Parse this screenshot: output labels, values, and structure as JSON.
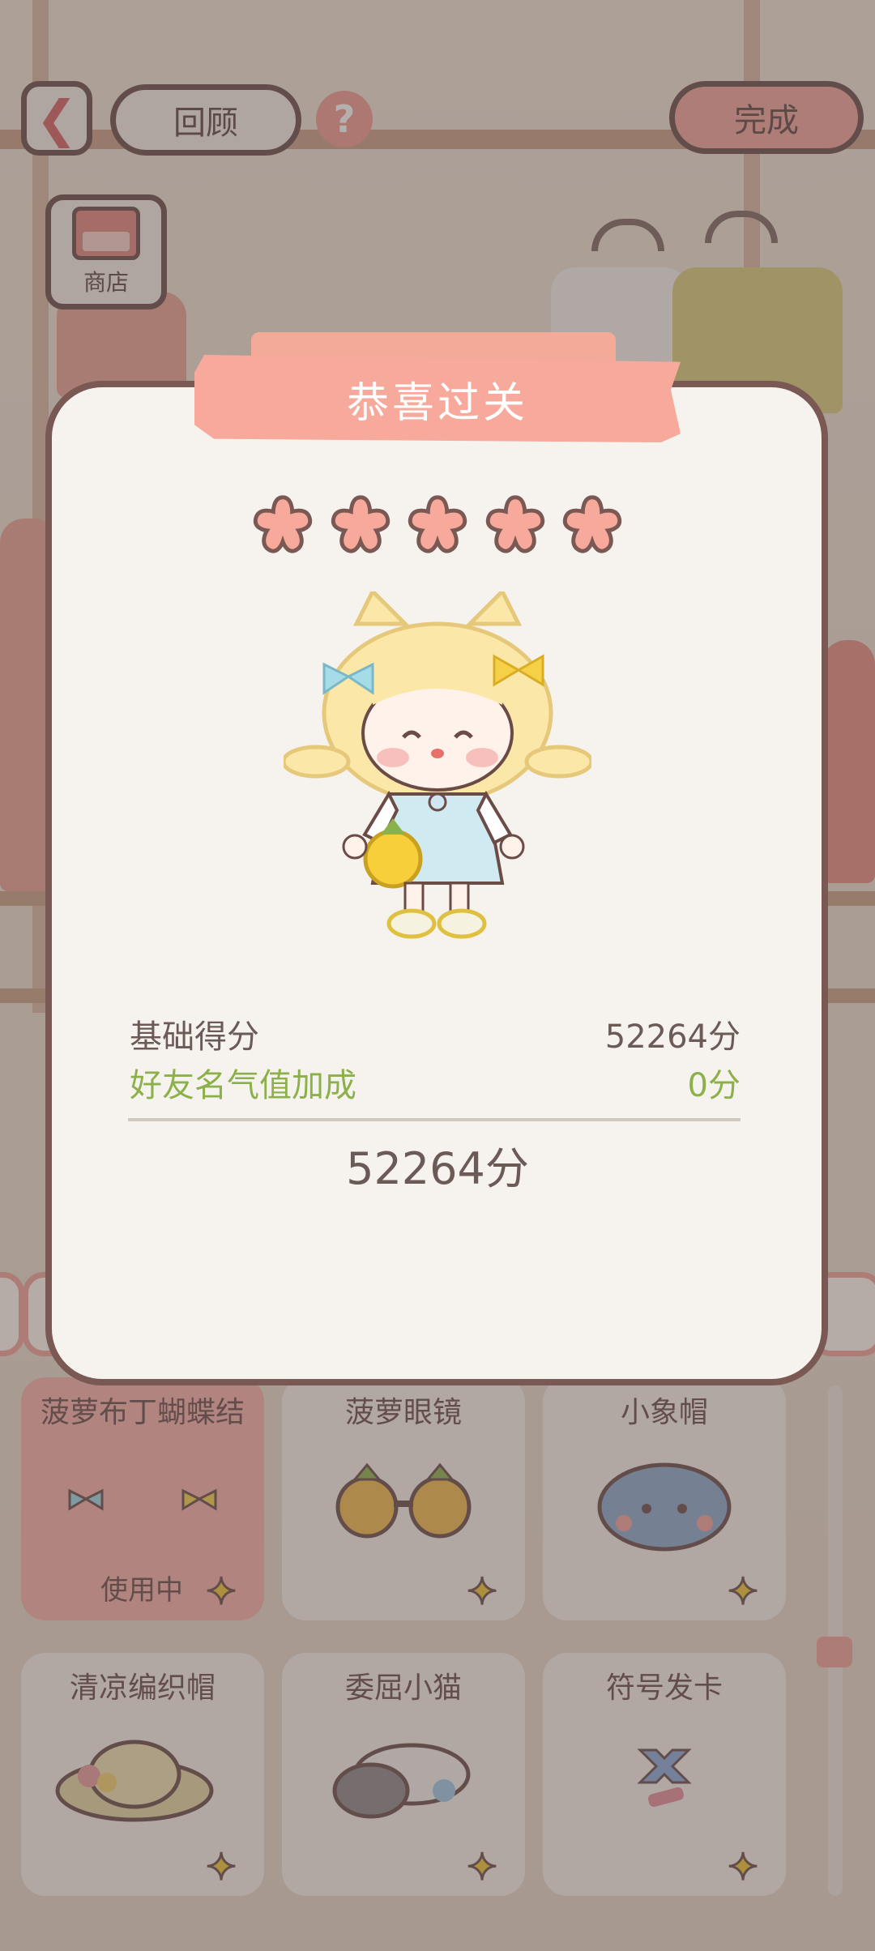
{
  "topbar": {
    "back_icon": "chevron-left-icon",
    "review_label": "回顾",
    "help_icon": "question-icon",
    "help_glyph": "?",
    "done_label": "完成"
  },
  "shop": {
    "label": "商店",
    "icon": "shop-icon"
  },
  "dialog": {
    "title": "恭喜过关",
    "stars_count": 5,
    "star_color": "#f7a99b",
    "base_label": "基础得分",
    "base_value": "52264分",
    "bonus_label": "好友名气值加成",
    "bonus_value": "0分",
    "total": "52264分",
    "colors": {
      "bonus": "#8cb14a",
      "banner": "#f7a99b"
    }
  },
  "items": [
    {
      "name": "菠萝布丁蝴蝶结",
      "status": "使用中",
      "active": true
    },
    {
      "name": "菠萝眼镜",
      "status": "",
      "active": false
    },
    {
      "name": "小象帽",
      "status": "",
      "active": false
    },
    {
      "name": "清凉编织帽",
      "status": "",
      "active": false
    },
    {
      "name": "委屈小猫",
      "status": "",
      "active": false
    },
    {
      "name": "符号发卡",
      "status": "",
      "active": false
    }
  ],
  "star_badge_icon": "sparkle-star-icon"
}
